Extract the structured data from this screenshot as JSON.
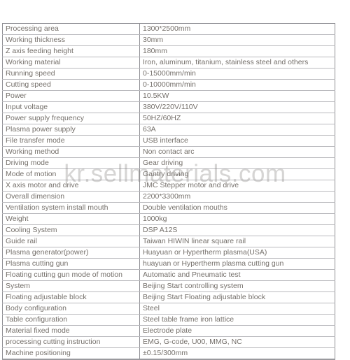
{
  "watermark": {
    "text": "kr.sellmaterials.com"
  },
  "table": {
    "name": "machine-specification-table",
    "columns": [
      "parameter",
      "value"
    ],
    "rows": [
      {
        "label": "Processing area",
        "value": "1300*2500mm"
      },
      {
        "label": "Working thickness",
        "value": "30mm"
      },
      {
        "label": "Z axis feeding height",
        "value": "180mm"
      },
      {
        "label": "Working material",
        "value": "Iron, aluminum, titanium, stainless steel and others"
      },
      {
        "label": "Running speed",
        "value": "0-15000mm/min"
      },
      {
        "label": "Cutting speed",
        "value": "0-10000mm/min"
      },
      {
        "label": "Power",
        "value": "10.5KW"
      },
      {
        "label": "Input voltage",
        "value": "380V/220V/110V"
      },
      {
        "label": "Power supply frequency",
        "value": "50HZ/60HZ"
      },
      {
        "label": "Plasma power supply",
        "value": "63A"
      },
      {
        "label": "File transfer mode",
        "value": "USB interface"
      },
      {
        "label": "Working method",
        "value": "Non contact arc"
      },
      {
        "label": "Driving mode",
        "value": "Gear driving"
      },
      {
        "label": "Mode of motion",
        "value": "Gantry driving"
      },
      {
        "label": "X axis motor and drive",
        "value": "JMC Stepper motor and drive"
      },
      {
        "label": "Overall dimension",
        "value": "2200*3300mm"
      },
      {
        "label": "Ventilation system install mouth",
        "value": "Double ventilation mouths"
      },
      {
        "label": "Weight",
        "value": "1000kg"
      },
      {
        "label": "Cooling System",
        "value": " DSP A12S"
      },
      {
        "label": "Guide rail",
        "value": "Taiwan HIWIN linear square rail"
      },
      {
        "label": "Plasma generator(power)",
        "value": "Huayuan or Hypertherm plasma(USA)"
      },
      {
        "label": "Plasma cutting gun",
        "value": "huayuan or Hypertherm plasma cutting gun"
      },
      {
        "label": "Floating cutting gun mode of motion",
        "value": "Automatic and Pneumatic test"
      },
      {
        "label": "System",
        "value": "Beijing Start controlling system"
      },
      {
        "label": "Floating adjustable block",
        "value": "Beijing Start Floating adjustable block"
      },
      {
        "label": "Body configuration",
        "value": "Steel"
      },
      {
        "label": "Table configuration",
        "value": "Steel table frame iron lattice"
      },
      {
        "label": "Material fixed mode",
        "value": "Electrode plate"
      },
      {
        "label": "processing cutting instruction",
        "value": "EMG, G-code, U00, MMG, NC"
      },
      {
        "label": "Machine positioning",
        "value": "±0.15/300mm"
      }
    ]
  },
  "colors": {
    "text": "#75706b",
    "border_outer": "#8e8e93",
    "border_inner": "#b9b9bd",
    "background": "#ffffff"
  }
}
